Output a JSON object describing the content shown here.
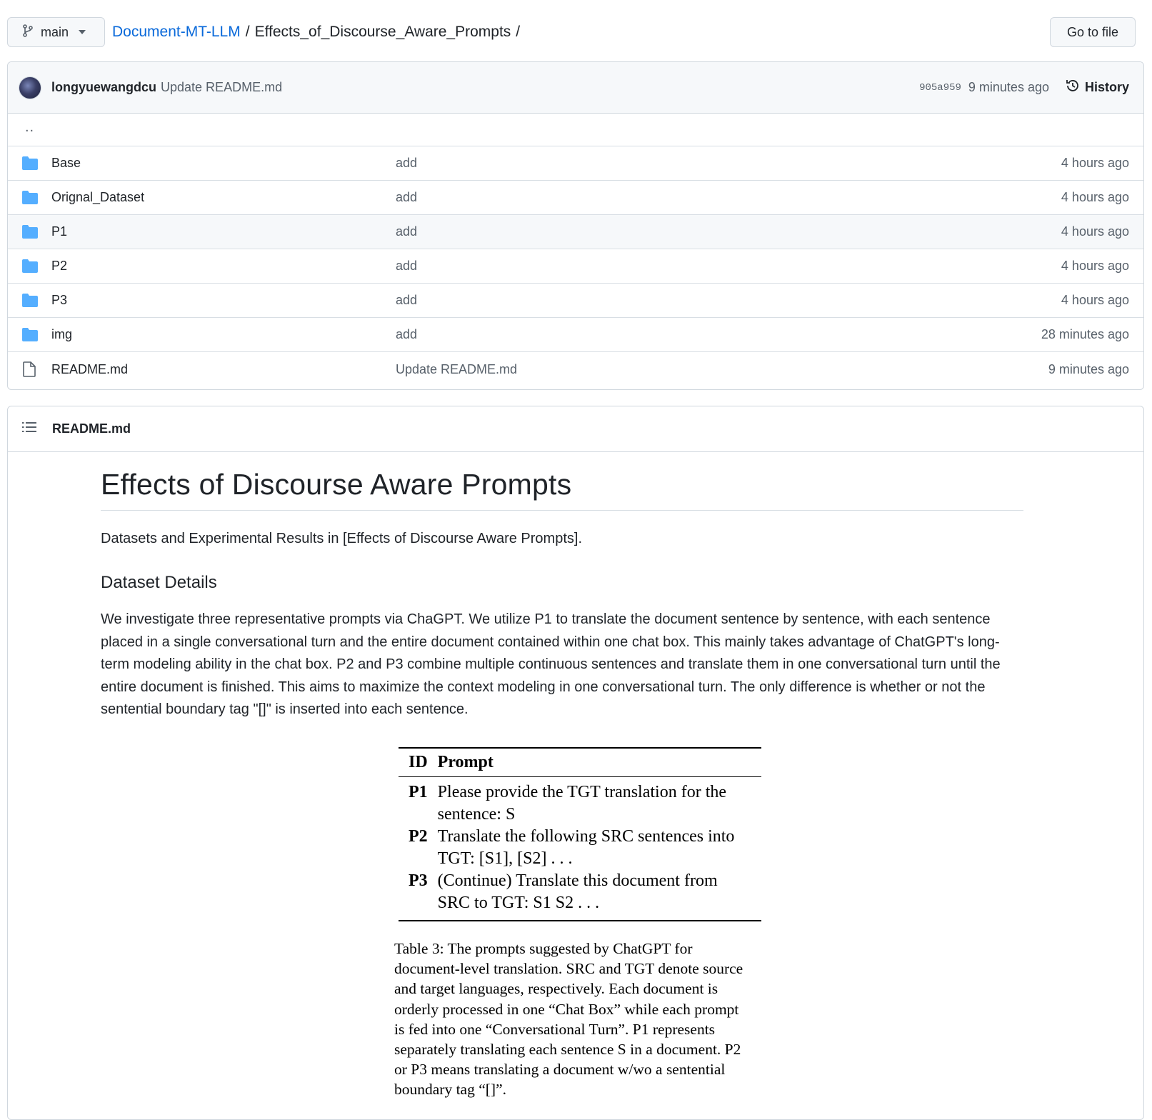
{
  "topbar": {
    "branch": "main",
    "breadcrumb_repo": "Document-MT-LLM",
    "breadcrumb_sep": "/",
    "breadcrumb_folder": "Effects_of_Discourse_Aware_Prompts",
    "breadcrumb_trail": "/",
    "goto_label": "Go to file"
  },
  "commit": {
    "author": "longyuewangdcu",
    "message": "Update README.md",
    "sha": "905a959",
    "age": "9 minutes ago",
    "history_label": "History"
  },
  "files": {
    "updir": "..",
    "rows": [
      {
        "name": "Base",
        "message": "add",
        "age": "4 hours ago",
        "type": "folder"
      },
      {
        "name": "Orignal_Dataset",
        "message": "add",
        "age": "4 hours ago",
        "type": "folder"
      },
      {
        "name": "P1",
        "message": "add",
        "age": "4 hours ago",
        "type": "folder"
      },
      {
        "name": "P2",
        "message": "add",
        "age": "4 hours ago",
        "type": "folder"
      },
      {
        "name": "P3",
        "message": "add",
        "age": "4 hours ago",
        "type": "folder"
      },
      {
        "name": "img",
        "message": "add",
        "age": "28 minutes ago",
        "type": "folder"
      },
      {
        "name": "README.md",
        "message": "Update README.md",
        "age": "9 minutes ago",
        "type": "file"
      }
    ]
  },
  "readme": {
    "header": "README.md",
    "title": "Effects of Discourse Aware Prompts",
    "intro": "Datasets and Experimental Results in [Effects of Discourse Aware Prompts].",
    "section_title": "Dataset Details",
    "body": "We investigate three representative prompts via ChaGPT. We utilize P1 to translate the document sentence by sentence, with each sentence placed in a single conversational turn and the entire document contained within one chat box. This mainly takes advantage of ChatGPT's long-term modeling ability in the chat box. P2 and P3 combine multiple continuous sentences and translate them in one conversational turn until the entire document is finished. This aims to maximize the context modeling in one conversational turn. The only difference is whether or not the sentential boundary tag \"[]\" is inserted into each sentence."
  },
  "paper_table": {
    "col_id": "ID",
    "col_prompt": "Prompt",
    "rows": [
      {
        "id": "P1",
        "line1": "Please provide the TGT translation for the",
        "line2": "sentence: S"
      },
      {
        "id": "P2",
        "line1": "Translate the following SRC sentences into",
        "line2": "TGT: [S1], [S2] . . ."
      },
      {
        "id": "P3",
        "line1": "(Continue) Translate this document from",
        "line2": "SRC to TGT: S1 S2 . . ."
      }
    ],
    "caption_lines": [
      "Table 3:  The prompts suggested by ChatGPT for",
      "document-level translation. SRC and TGT denote source",
      "and target languages, respectively.  Each document is",
      "orderly processed in one “Chat Box” while each prompt",
      "is fed into one “Conversational Turn”.  P1 represents",
      "separately translating each sentence S in a document. P2",
      "or P3 means translating a document w/wo a sentential",
      "boundary tag “[]”."
    ]
  },
  "colors": {
    "link": "#0969da",
    "folder": "#54aeff",
    "border": "#d0d7de",
    "muted": "#57606a"
  }
}
